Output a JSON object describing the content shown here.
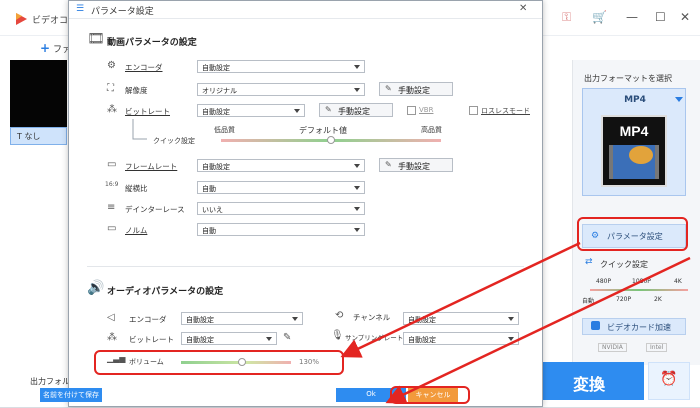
{
  "app": {
    "title": "ビデオコ",
    "add_label": "ファ",
    "subtitle_option": "なし",
    "output_folder_label": "出力フォル",
    "output_format_label": "出力フォーマットを選択",
    "format_name": "MP4",
    "format_icon_text": "MP4",
    "param_settings_button": "パラメータ設定",
    "quick_settings_label": "クイック設定",
    "quick_scale_top": [
      "480P",
      "1080P",
      "4K"
    ],
    "quick_scale_bottom": [
      "自動",
      "720P",
      "2K"
    ],
    "gpu_accel_button": "ビデオカード加速",
    "gpu_logos": [
      "NVIDIA",
      "Intel"
    ],
    "convert_button": "変換"
  },
  "dialog": {
    "title": "パラメータ設定",
    "video_section_title": "動画パラメータの設定",
    "video_rows": {
      "encoder": {
        "label": "エンコーダ",
        "value": "自動設定"
      },
      "resolution": {
        "label": "解像度",
        "value": "オリジナル",
        "button": "手動設定"
      },
      "bitrate": {
        "label": "ビットレート",
        "value": "自動設定",
        "button": "手動設定",
        "vbr_label": "VBR",
        "lossless_label": "ロスレスモード"
      },
      "quality": {
        "label": "クイック設定",
        "low": "低品質",
        "default": "デフォルト値",
        "high": "高品質",
        "level": 0.5
      },
      "framerate": {
        "label": "フレームレート",
        "value": "自動設定",
        "button": "手動設定"
      },
      "aspect": {
        "label": "縦横比",
        "value": "自動"
      },
      "deinterlace": {
        "label": "デインターレース",
        "value": "いいえ"
      },
      "normal": {
        "label": "ノルム",
        "value": "自動"
      }
    },
    "audio_section_title": "オーディオパラメータの設定",
    "audio_rows": {
      "encoder": {
        "label": "エンコーダ",
        "value": "自動設定"
      },
      "channel": {
        "label": "チャンネル",
        "value": "自動設定"
      },
      "bitrate": {
        "label": "ビットレート",
        "value": "自動設定"
      },
      "samplerate": {
        "label": "サンプリングレート",
        "value": "自動設定"
      },
      "volume": {
        "label": "ボリューム",
        "value_text": "130%",
        "level": 0.55
      }
    },
    "save_as_button": "名前を付けて保存",
    "ok_button": "Ok",
    "cancel_button": "キャンセル"
  },
  "colors": {
    "accent": "#2e8cf0",
    "cancel": "#f29a3c",
    "highlight": "#e32521"
  }
}
